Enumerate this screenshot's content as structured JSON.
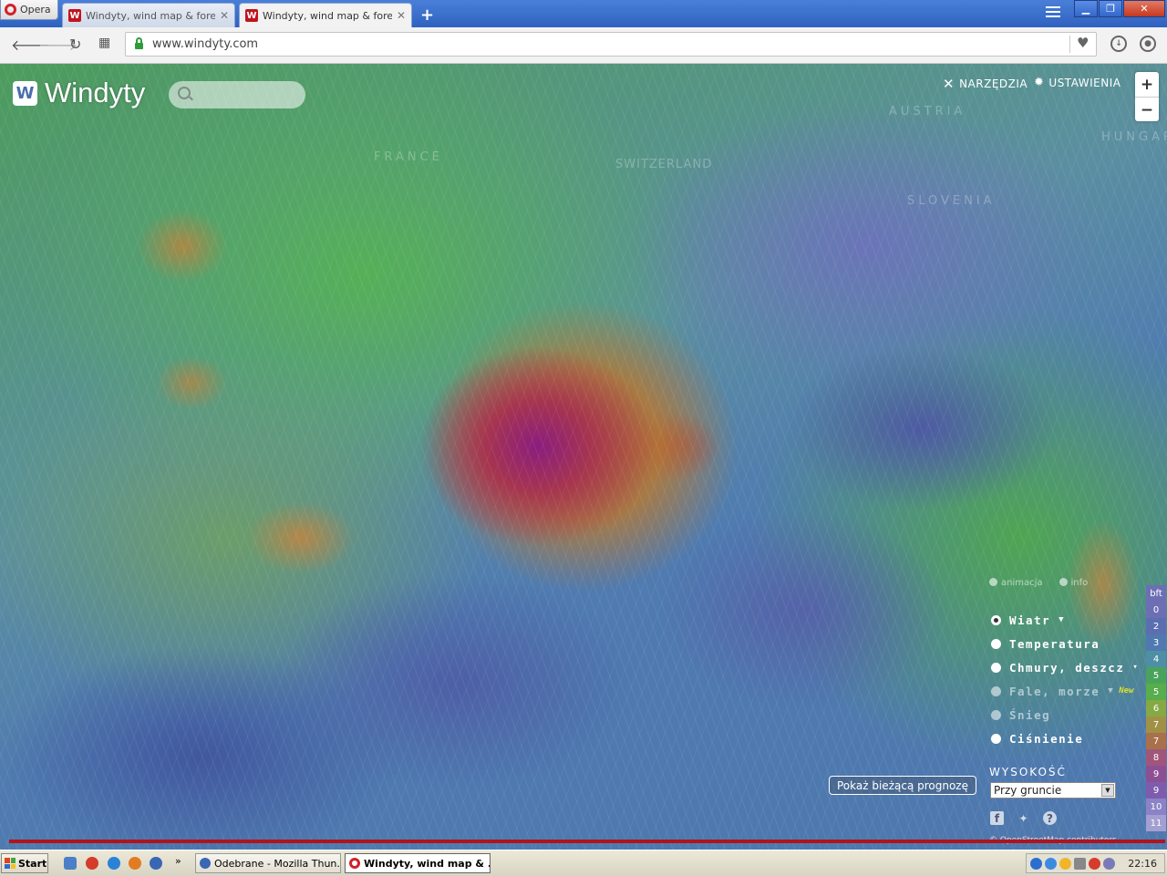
{
  "browser": {
    "menu_label": "Opera",
    "tabs": [
      {
        "title": "Windyty, wind map & forecast",
        "active": false
      },
      {
        "title": "Windyty, wind map & forecast",
        "active": true
      }
    ],
    "url": "www.windyty.com"
  },
  "app": {
    "logo_text": "Windyty",
    "search_placeholder": "",
    "menu": {
      "tools": "NARZĘDZIA",
      "settings": "USTAWIENIA"
    },
    "zoom": {
      "in": "+",
      "out": "−"
    },
    "map_labels": [
      "FRANCE",
      "SWITZERLAND",
      "AUSTRIA",
      "SLOVENIA",
      "HUNGARY"
    ],
    "animation_label": "animacja",
    "info_label": "info",
    "layers": [
      {
        "label": "Wiatr",
        "selected": true,
        "dim": false,
        "caret": true,
        "badge": ""
      },
      {
        "label": "Temperatura",
        "selected": false,
        "dim": false,
        "caret": false,
        "badge": ""
      },
      {
        "label": "Chmury, deszcz",
        "selected": false,
        "dim": false,
        "caret": true,
        "badge": ""
      },
      {
        "label": "Fale, morze",
        "selected": false,
        "dim": true,
        "caret": true,
        "badge": "New"
      },
      {
        "label": "Śnieg",
        "selected": false,
        "dim": true,
        "caret": false,
        "badge": ""
      },
      {
        "label": "Ciśnienie",
        "selected": false,
        "dim": false,
        "caret": false,
        "badge": ""
      }
    ],
    "altitude_title": "WYSOKOŚĆ",
    "altitude_value": "Przy gruncie",
    "show_forecast_label": "Pokaż bieżącą prognozę",
    "attribution": "© OpenStreetMap contributors",
    "legend": {
      "unit": "bft",
      "values": [
        "0",
        "2",
        "3",
        "4",
        "5",
        "5",
        "6",
        "7",
        "7",
        "8",
        "9",
        "9",
        "10",
        "11"
      ],
      "colors": [
        "#6d6fb4",
        "#5b6fb0",
        "#4f79b0",
        "#4e8fa5",
        "#4aa35c",
        "#58ad4c",
        "#84a945",
        "#a09146",
        "#a8704b",
        "#a0567a",
        "#8d4f93",
        "#7e5cad",
        "#8b82c7",
        "#a39fd1"
      ]
    },
    "progress": 1.0
  },
  "taskbar": {
    "start_label": "Start",
    "tasks": [
      {
        "label": "Odebrane - Mozilla Thun...",
        "active": false
      },
      {
        "label": "Windyty, wind map & ...",
        "active": true
      }
    ],
    "clock": "22:16"
  }
}
